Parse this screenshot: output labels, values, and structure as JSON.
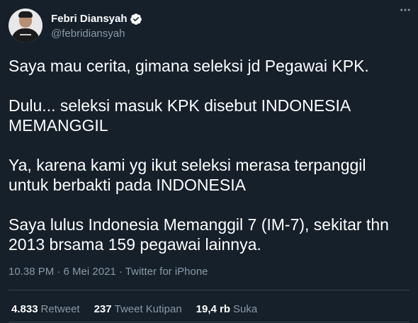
{
  "author": {
    "display_name": "Febri Diansyah",
    "handle": "@febridiansyah",
    "verified": true
  },
  "icons": {
    "more": "more-horizontal-icon",
    "verified": "verified-badge-icon"
  },
  "tweet": {
    "text": "Saya mau cerita, gimana seleksi jd Pegawai KPK.\n\nDulu... seleksi masuk KPK disebut INDONESIA MEMANGGIL\n\nYa, karena kami yg ikut seleksi merasa terpanggil untuk berbakti pada INDONESIA\n\nSaya lulus Indonesia Memanggil 7 (IM-7), sekitar thn 2013 brsama 159 pegawai lainnya.",
    "meta": "10.38 PM · 6 Mei 2021 · Twitter for iPhone"
  },
  "stats": {
    "retweets": {
      "count": "4.833",
      "label": "Retweet"
    },
    "quotes": {
      "count": "237",
      "label": "Tweet Kutipan"
    },
    "likes": {
      "count": "19,4 rb",
      "label": "Suka"
    }
  },
  "colors": {
    "background": "#15202b",
    "text": "#ffffff",
    "muted": "#8899a6",
    "verified": "#ffffff",
    "divider": "#38444d"
  }
}
